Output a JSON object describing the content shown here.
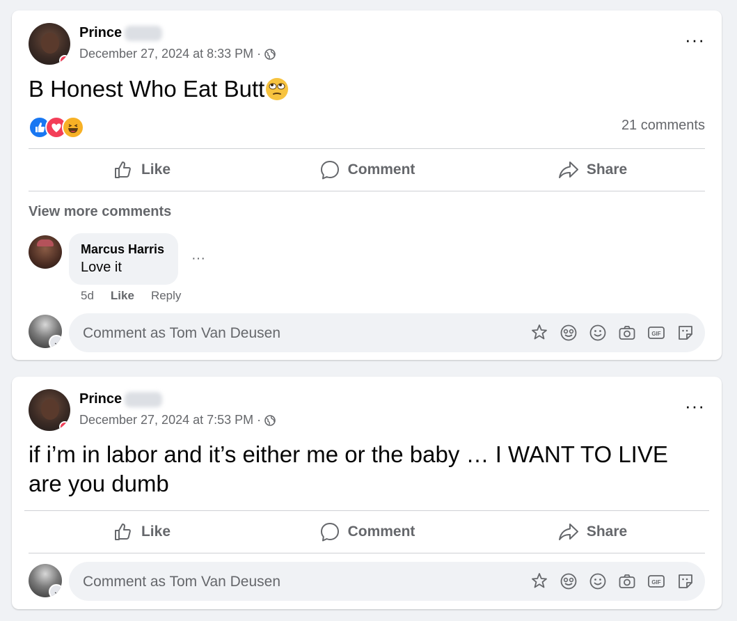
{
  "posts": [
    {
      "author": "Prince",
      "timestamp": "December 27, 2024 at 8:33 PM",
      "separator": "·",
      "text": "B Honest Who Eat Butt",
      "emoji": "eye-roll-emoji",
      "reactions": [
        "like",
        "love",
        "haha"
      ],
      "comment_count": "21 comments",
      "actions": {
        "like": "Like",
        "comment": "Comment",
        "share": "Share"
      },
      "view_more": "View more comments",
      "comment": {
        "author": "Marcus Harris",
        "text": "Love it",
        "age": "5d",
        "like": "Like",
        "reply": "Reply",
        "more": "···"
      },
      "comment_input_placeholder": "Comment as Tom Van Deusen",
      "more": "···"
    },
    {
      "author": "Prince",
      "timestamp": "December 27, 2024 at 7:53 PM",
      "separator": "·",
      "text": "if i’m in labor and it’s either me or the baby … I WANT TO LIVE are you dumb",
      "actions": {
        "like": "Like",
        "comment": "Comment",
        "share": "Share"
      },
      "comment_input_placeholder": "Comment as Tom Van Deusen",
      "more": "···"
    }
  ],
  "composer_icons": [
    "avatar-sticker-icon",
    "emoji-sticker-icon",
    "smiley-icon",
    "camera-icon",
    "gif-icon",
    "sticker-icon"
  ],
  "colors": {
    "background": "#f0f2f5",
    "card": "#ffffff",
    "secondary_text": "#65676b",
    "like_blue": "#1877f2",
    "love_red": "#f33e58",
    "haha_yellow": "#f7b125"
  }
}
